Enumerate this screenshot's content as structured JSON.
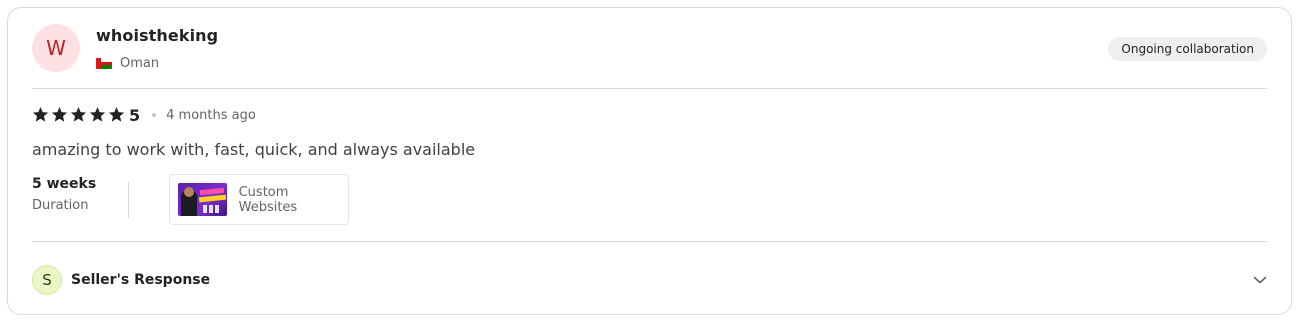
{
  "reviewer": {
    "avatar_letter": "W",
    "username": "whoistheking",
    "country": "Oman",
    "country_flag_icon": "oman-flag-icon",
    "badge": "Ongoing collaboration"
  },
  "rating": {
    "stars": 5,
    "value": "5",
    "time_ago": "4 months ago",
    "star_icon": "star-icon"
  },
  "review": {
    "text": "amazing to work with, fast, quick, and always available"
  },
  "duration": {
    "value": "5 weeks",
    "label": "Duration"
  },
  "gig": {
    "title": "Custom Websites",
    "thumbnail_icon": "gig-thumbnail"
  },
  "seller_response": {
    "avatar_letter": "S",
    "label": "Seller's Response",
    "toggle_icon": "chevron-down-icon"
  },
  "colors": {
    "avatar_bg": "#fde0e1",
    "avatar_text": "#b3262e",
    "seller_avatar_bg": "#eaf6c6",
    "border": "#dadbdd",
    "star": "#222325"
  }
}
